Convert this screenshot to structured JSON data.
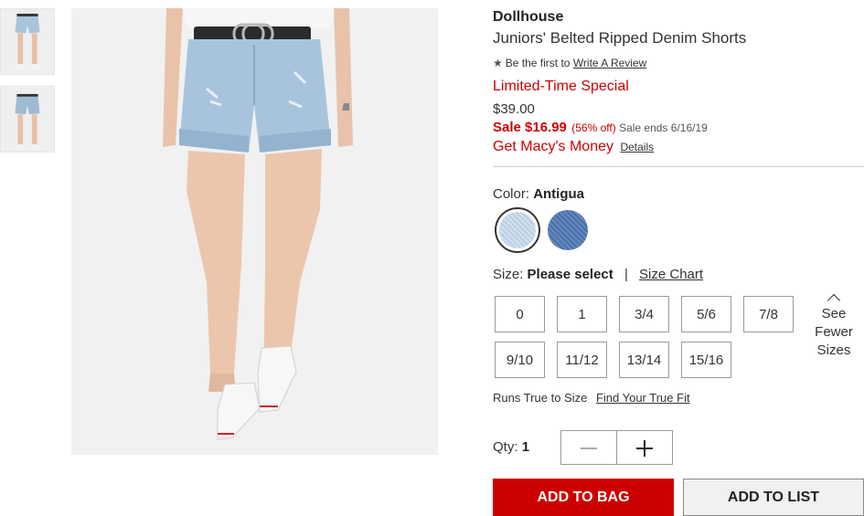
{
  "product": {
    "brand": "Dollhouse",
    "name": "Juniors' Belted Ripped Denim Shorts",
    "review_prefix": "Be the first to",
    "review_link": "Write A Review",
    "star_icon": "★",
    "special": "Limited-Time Special",
    "regular_price": "$39.00",
    "sale_price": "Sale $16.99",
    "discount": "(56% off)",
    "sale_ends": "Sale ends 6/16/19",
    "money_text": "Get Macy's Money",
    "money_link": "Details"
  },
  "color": {
    "label": "Color:",
    "value": "Antigua",
    "swatches": [
      "Antigua",
      "Dark Wash"
    ]
  },
  "size": {
    "label": "Size:",
    "value": "Please select",
    "separator": "|",
    "chart_link": "Size Chart",
    "options": [
      "0",
      "1",
      "3/4",
      "5/6",
      "7/8",
      "9/10",
      "11/12",
      "13/14",
      "15/16"
    ],
    "see_fewer": [
      "See",
      "Fewer",
      "Sizes"
    ]
  },
  "fit": {
    "text": "Runs True to Size",
    "link": "Find Your True Fit"
  },
  "quantity": {
    "label": "Qty:",
    "value": "1"
  },
  "actions": {
    "add_to_bag": "ADD TO BAG",
    "add_to_list": "ADD TO LIST"
  },
  "colors": {
    "accent": "#cc0000",
    "text": "#333333"
  }
}
